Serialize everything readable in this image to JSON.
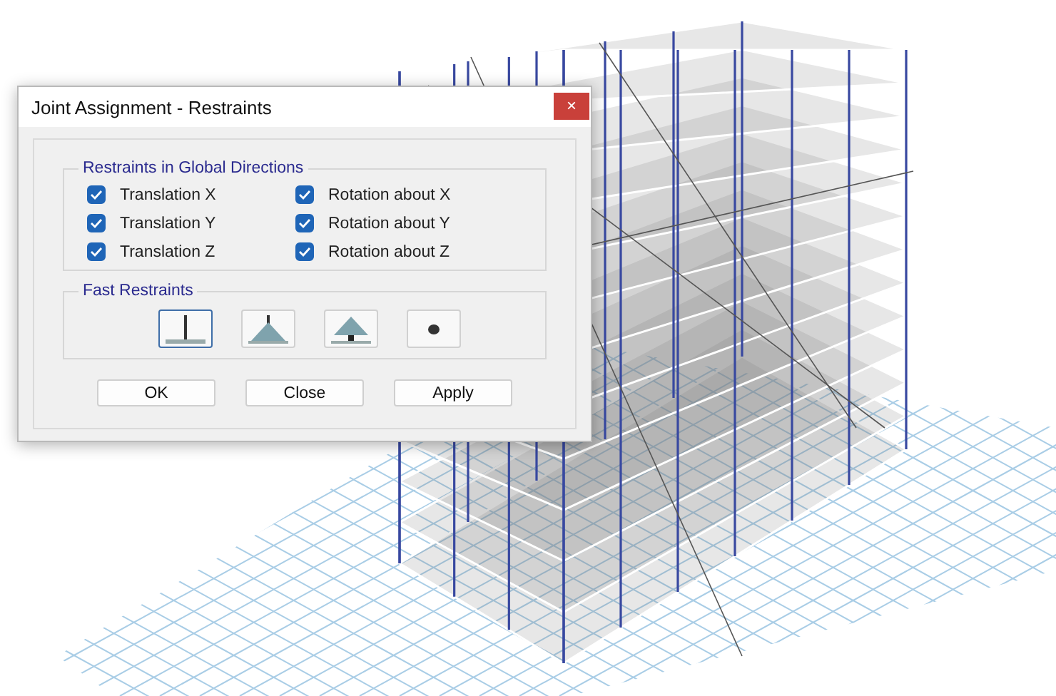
{
  "dialog": {
    "title": "Joint Assignment - Restraints",
    "close": "×",
    "global_directions": {
      "title": "Restraints in Global Directions",
      "items": [
        {
          "label": "Translation X",
          "checked": true
        },
        {
          "label": "Rotation about X",
          "checked": true
        },
        {
          "label": "Translation Y",
          "checked": true
        },
        {
          "label": "Rotation about Y",
          "checked": true
        },
        {
          "label": "Translation Z",
          "checked": true
        },
        {
          "label": "Rotation about Z",
          "checked": true
        }
      ]
    },
    "fast_restraints": {
      "title": "Fast Restraints",
      "items": [
        {
          "kind": "fixed",
          "selected": true
        },
        {
          "kind": "pinned",
          "selected": false
        },
        {
          "kind": "roller",
          "selected": false
        },
        {
          "kind": "free",
          "selected": false
        }
      ]
    },
    "buttons": [
      "OK",
      "Close",
      "Apply"
    ]
  }
}
